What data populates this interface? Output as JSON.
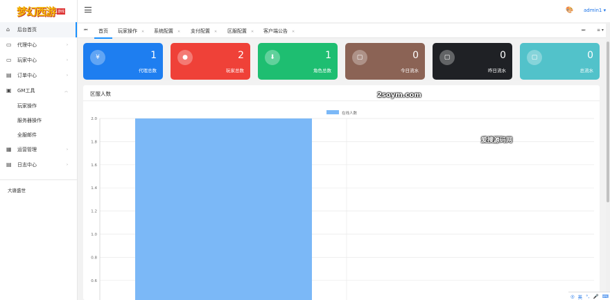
{
  "sidebar": {
    "logo": "梦幻西游",
    "logo_badge": "游戏",
    "items": [
      {
        "label": "后台首页",
        "icon": "home-icon",
        "glyph": "⌂"
      },
      {
        "label": "代理中心",
        "icon": "agent-icon",
        "glyph": "▭"
      },
      {
        "label": "玩家中心",
        "icon": "player-icon",
        "glyph": "▭"
      },
      {
        "label": "订单中心",
        "icon": "order-icon",
        "glyph": "▤"
      },
      {
        "label": "GM工具",
        "icon": "gm-tool-icon",
        "glyph": "▣"
      }
    ],
    "gm_sub": [
      "玩家操作",
      "服务器操作",
      "全服邮件"
    ],
    "items2": [
      {
        "label": "运营管理",
        "icon": "operation-icon",
        "glyph": "▦"
      },
      {
        "label": "日志中心",
        "icon": "log-icon",
        "glyph": "▤"
      }
    ],
    "footer": "大唐盛世"
  },
  "topbar": {
    "user": "admin1 ▾"
  },
  "tabs": [
    "首页",
    "玩家操作",
    "系统配置",
    "支付配置",
    "区服配置",
    "客户端公告"
  ],
  "cards": [
    {
      "value": "1",
      "label": "代理总数",
      "icon": "yen-icon",
      "glyph": "¥",
      "color": "#1e7ef0"
    },
    {
      "value": "2",
      "label": "玩家总数",
      "icon": "user-icon",
      "glyph": "●",
      "color": "#ef4138"
    },
    {
      "value": "1",
      "label": "角色总数",
      "icon": "download-icon",
      "glyph": "⬇",
      "color": "#1ebe71"
    },
    {
      "value": "0",
      "label": "今日流水",
      "icon": "message-icon",
      "glyph": "▢",
      "color": "#8b6355"
    },
    {
      "value": "0",
      "label": "昨日流水",
      "icon": "message-icon",
      "glyph": "▢",
      "color": "#1f2125"
    },
    {
      "value": "0",
      "label": "总流水",
      "icon": "message-icon",
      "glyph": "▢",
      "color": "#52c2ca"
    }
  ],
  "panel": {
    "title": "区服人数"
  },
  "watermarks": {
    "site": "2soym.com",
    "cn": "爱搜源码网"
  },
  "ime": {
    "lang": "英"
  },
  "chart_data": {
    "type": "bar",
    "categories": [
      ""
    ],
    "series": [
      {
        "name": "在线人数",
        "values": [
          2
        ]
      }
    ],
    "ylim_visible": [
      0.5,
      2.0
    ],
    "yticks": [
      "2.0",
      "1.8",
      "1.6",
      "1.4",
      "1.2",
      "1.0",
      "0.8",
      "0.6"
    ],
    "legend": "top-center",
    "grid": true,
    "bar_color": "#7bb8f7"
  }
}
